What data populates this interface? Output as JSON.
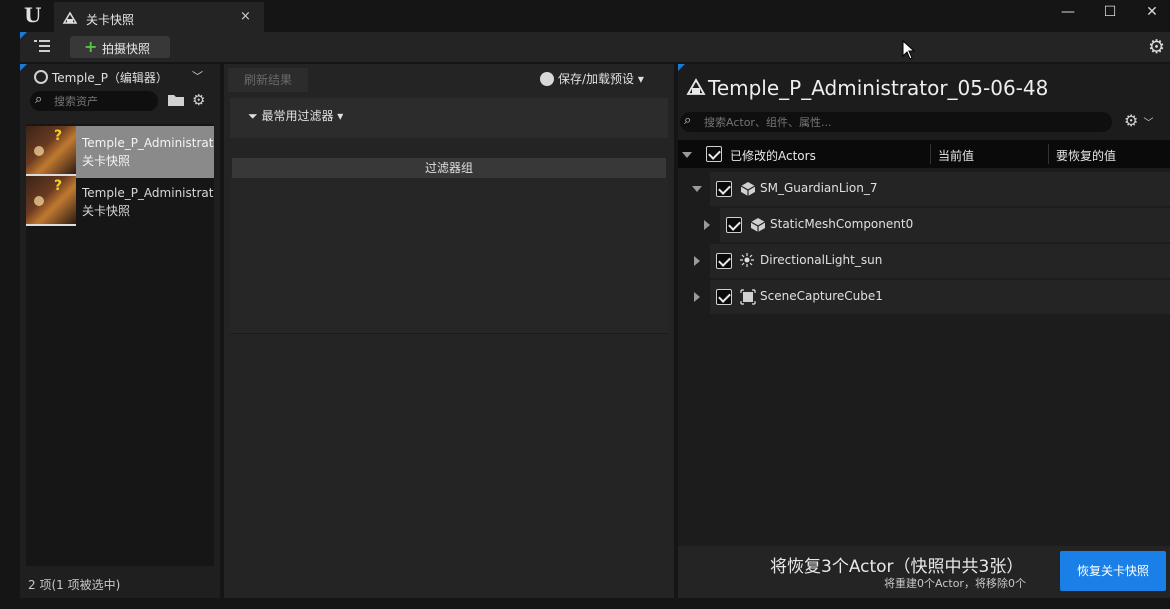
{
  "window": {
    "tab_title": "关卡快照",
    "tab_close": "×",
    "minimize": "—",
    "maximize": "☐",
    "close": "✕"
  },
  "toolbar": {
    "take_snapshot_label": "拍摄快照"
  },
  "left_panel": {
    "level_title": "Temple_P（编辑器）",
    "search_placeholder": "搜索资产",
    "assets": [
      {
        "name": "Temple_P_Administrator",
        "type": "关卡快照",
        "selected": true
      },
      {
        "name": "Temple_P_Administrator",
        "type": "关卡快照",
        "selected": false
      }
    ],
    "item_count": "2 项(1 项被选中)"
  },
  "middle_panel": {
    "refresh_label": "刷新结果",
    "save_load_preset": "保存/加载预设",
    "common_filters": "最常用过滤器",
    "filter_group": "过滤器组"
  },
  "right_panel": {
    "snapshot_title": "Temple_P_Administrator_05-06-48",
    "search_placeholder": "搜索Actor、组件、属性...",
    "columns": {
      "modified_actors": "已修改的Actors",
      "current_value": "当前值",
      "restore_value": "要恢复的值"
    },
    "tree": [
      {
        "label": "SM_GuardianLion_7",
        "icon": "static-mesh-icon",
        "expanded": true,
        "checked": true,
        "depth": 0
      },
      {
        "label": "StaticMeshComponent0",
        "icon": "static-mesh-component-icon",
        "expanded": false,
        "checked": true,
        "depth": 1
      },
      {
        "label": "DirectionalLight_sun",
        "icon": "directional-light-icon",
        "expanded": false,
        "checked": true,
        "depth": 0
      },
      {
        "label": "SceneCaptureCube1",
        "icon": "scene-capture-icon",
        "expanded": false,
        "checked": true,
        "depth": 0
      }
    ],
    "restore_summary": "将恢复3个Actor（快照中共3张）",
    "restore_detail": "将重建0个Actor，将移除0个",
    "restore_button": "恢复关卡快照"
  },
  "colors": {
    "accent": "#1a80e8",
    "plus_green": "#5bc04a"
  }
}
